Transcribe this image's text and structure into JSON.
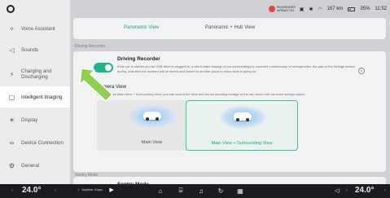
{
  "status": {
    "airbag_text": "PASSENGER AIRBAG ON",
    "range": "167 km",
    "battery": "35%",
    "time": "11:52"
  },
  "sidebar": {
    "items": [
      {
        "label": "Voice Assistant",
        "icon": "voice-icon"
      },
      {
        "label": "Sounds",
        "icon": "speaker-icon"
      },
      {
        "label": "Charging and Discharging",
        "icon": "charging-icon"
      },
      {
        "label": "Intelligent Imaging",
        "icon": "camera-icon",
        "active": true
      },
      {
        "label": "Display",
        "icon": "brightness-icon"
      },
      {
        "label": "Device Connection",
        "icon": "link-icon"
      },
      {
        "label": "General",
        "icon": "gear-icon"
      }
    ]
  },
  "tabs": [
    {
      "label": "Panoramic View",
      "active": true
    },
    {
      "label": "Panoramic + Hub View",
      "active": false
    }
  ],
  "driving_recorder": {
    "section_label": "Driving Recorder",
    "title": "Driving Recorder",
    "enabled": true,
    "description": "If the car is started and an USB drive is plugged in, a silent video footage of car surroundings is recorded continuously. In emergencies, the part of the footage before, during, and after the incident will be stored and locked in another place to show what is going on."
  },
  "camera_view": {
    "title": "Camera View",
    "description": "If you choose Main View + Surrounding View, you can record the front and the surrounding footage of the car, which will use more storage space.",
    "options": [
      {
        "label": "Main View",
        "selected": false
      },
      {
        "label": "Main View + Surrounding View",
        "selected": true
      }
    ]
  },
  "sentry": {
    "section_label": "Sentry Mode",
    "title": "Sentry Mode"
  },
  "bottom": {
    "temp_left": "24.0°",
    "temp_right": "24.0°",
    "music_title": "Anytime, Anyw.."
  },
  "colors": {
    "accent": "#13a882",
    "toggle_on": "#19b88b",
    "arrow": "#8fd14f",
    "bottom_bar": "#1a1c20"
  }
}
